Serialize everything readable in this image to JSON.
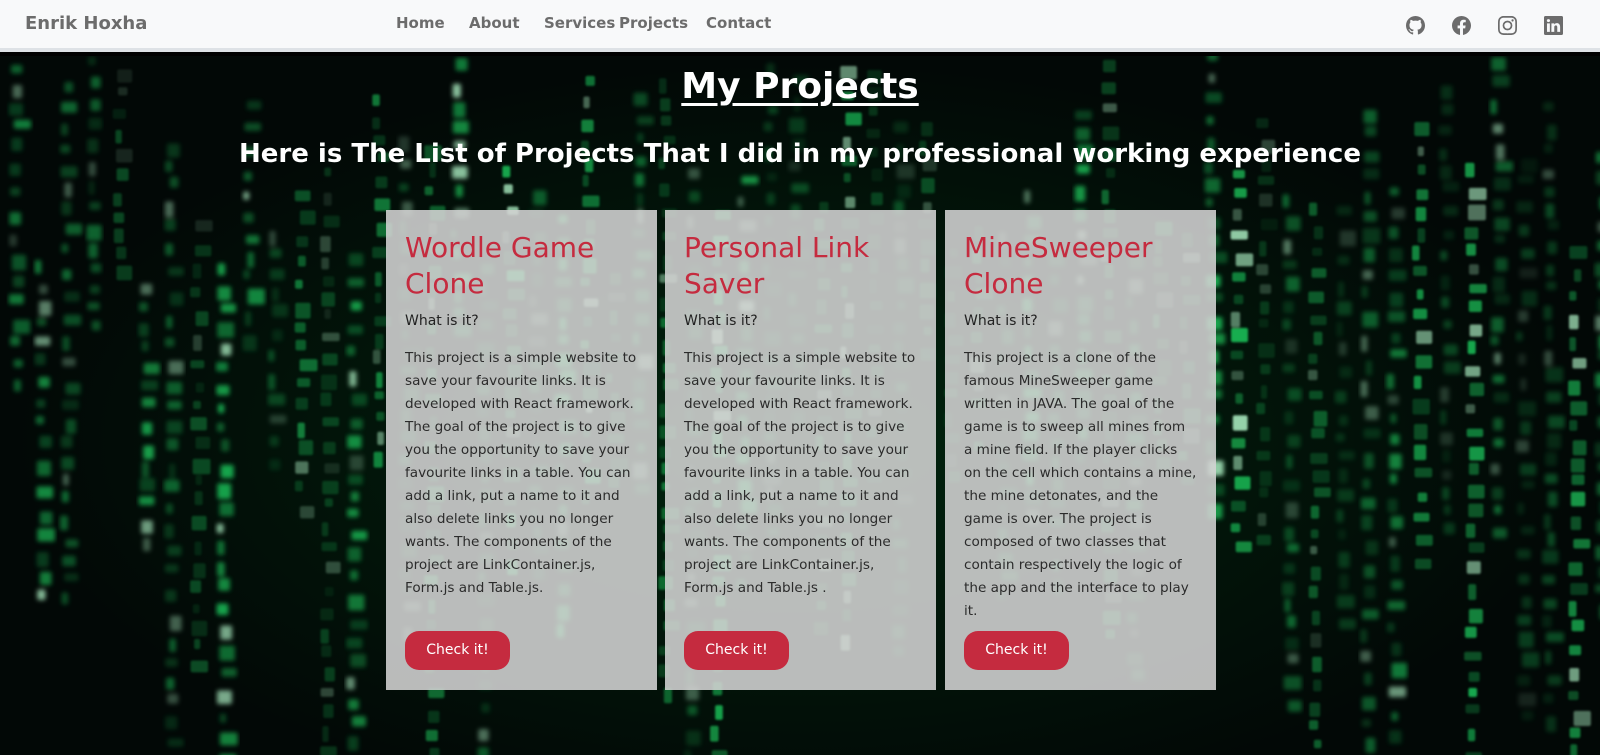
{
  "navbar": {
    "brand": "Enrik Hoxha",
    "links": [
      "Home",
      "About",
      "Services",
      "Projects",
      "Contact"
    ],
    "social_icons": [
      "github-icon",
      "facebook-icon",
      "instagram-icon",
      "linkedin-icon"
    ]
  },
  "header": {
    "title": "My Projects",
    "subtitle": "Here is The List of Projects That I did in my professional working experience"
  },
  "projects": [
    {
      "title": "Wordle Game Clone",
      "subtitle": "What is it?",
      "description": "This project is a simple website to save your favourite links. It is developed with React framework. The goal of the project is to give you the opportunity to save your favourite links in a table. You can add a link, put a name to it and also delete links you no longer wants. The components of the project are LinkContainer.js, Form.js and Table.js.",
      "button": "Check it!"
    },
    {
      "title": "Personal Link Saver",
      "subtitle": "What is it?",
      "description": "This project is a simple website to save your favourite links. It is developed with React framework. The goal of the project is to give you the opportunity to save your favourite links in a table. You can add a link, put a name to it and also delete links you no longer wants. The components of the project are LinkContainer.js, Form.js and Table.js .",
      "button": "Check it!"
    },
    {
      "title": "MineSweeper Clone",
      "subtitle": "What is it?",
      "description": "This project is a clone of the famous MineSweeper game written in JAVA. The goal of the game is to sweep all mines from a mine field. If the player clicks on the cell which contains a mine, the mine detonates, and the game is over. The project is composed of two classes that contain respectively the logic of the app and the interface to play it.",
      "button": "Check it!"
    }
  ],
  "colors": {
    "accent": "#c52b3f",
    "navbar_bg": "#f8f9fa",
    "nav_text": "#6c6c6c",
    "matrix_green": "#1fd663"
  }
}
